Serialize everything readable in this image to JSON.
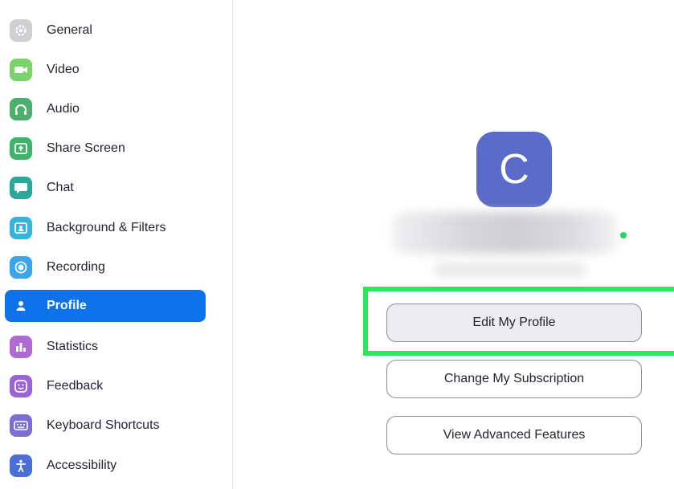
{
  "sidebar": {
    "items": [
      {
        "label": "General",
        "icon": "gear-icon",
        "color": "#d0d0d4",
        "active": false
      },
      {
        "label": "Video",
        "icon": "video-camera-icon",
        "color": "#7cd36b",
        "active": false
      },
      {
        "label": "Audio",
        "icon": "headphones-icon",
        "color": "#4caf6e",
        "active": false
      },
      {
        "label": "Share Screen",
        "icon": "share-screen-icon",
        "color": "#3fb36b",
        "active": false
      },
      {
        "label": "Chat",
        "icon": "chat-bubble-icon",
        "color": "#2aa89a",
        "active": false
      },
      {
        "label": "Background & Filters",
        "icon": "background-person-icon",
        "color": "#35b5d9",
        "active": false
      },
      {
        "label": "Recording",
        "icon": "record-icon",
        "color": "#3aa5e8",
        "active": false
      },
      {
        "label": "Profile",
        "icon": "person-icon",
        "color": "#0e72ed",
        "active": true
      },
      {
        "label": "Statistics",
        "icon": "bar-chart-icon",
        "color": "#b06ad4",
        "active": false
      },
      {
        "label": "Feedback",
        "icon": "smiley-icon",
        "color": "#9a63d6",
        "active": false
      },
      {
        "label": "Keyboard Shortcuts",
        "icon": "keyboard-icon",
        "color": "#7b6fd6",
        "active": false
      },
      {
        "label": "Accessibility",
        "icon": "accessibility-icon",
        "color": "#4a6fd6",
        "active": false
      }
    ]
  },
  "profile": {
    "avatar_initial": "C",
    "avatar_color": "#5b6bc9",
    "presence_color": "#23d959",
    "buttons": {
      "edit": "Edit My Profile",
      "subscription": "Change My Subscription",
      "advanced": "View Advanced Features"
    },
    "highlight_color": "#2ee65c"
  }
}
